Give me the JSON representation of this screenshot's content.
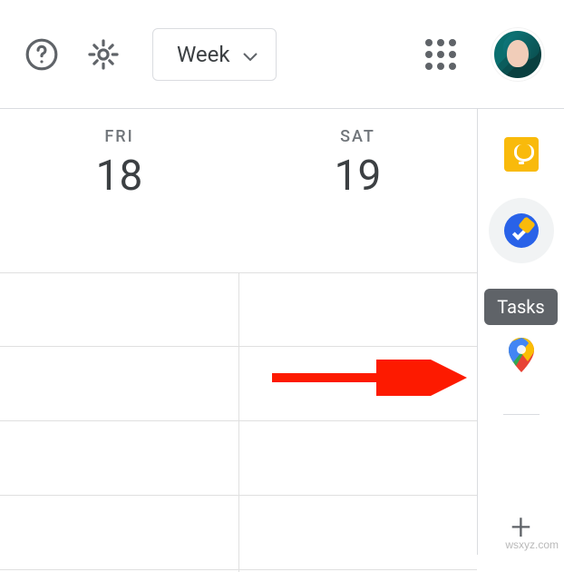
{
  "topbar": {
    "view_label": "Week"
  },
  "days": [
    {
      "name": "FRI",
      "num": "18"
    },
    {
      "name": "SAT",
      "num": "19"
    }
  ],
  "sidepanel": {
    "tooltip_tasks": "Tasks"
  },
  "watermark": "wsxyz.com"
}
